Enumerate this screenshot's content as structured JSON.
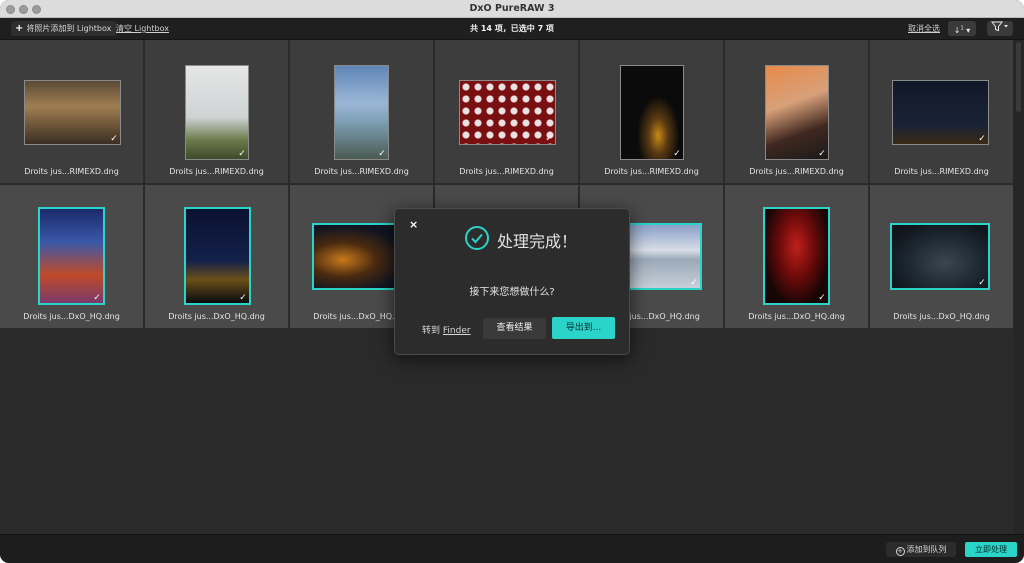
{
  "window": {
    "title": "DxO PureRAW 3"
  },
  "toolbar": {
    "add_label": "将照片添加到 Lightbox",
    "clear_label": "清空 Lightbox",
    "count_label": "共 14 项，已选中 7 项",
    "deselect_label": "取消全选",
    "sort_icon": "sort-icon",
    "filter_icon": "filter-icon"
  },
  "thumbnails": [
    {
      "name": "Droits jus...RIMEXD.dng",
      "selected": false
    },
    {
      "name": "Droits jus...RIMEXD.dng",
      "selected": false
    },
    {
      "name": "Droits jus...RIMEXD.dng",
      "selected": false
    },
    {
      "name": "Droits jus...RIMEXD.dng",
      "selected": false
    },
    {
      "name": "Droits jus...RIMEXD.dng",
      "selected": false
    },
    {
      "name": "Droits jus...RIMEXD.dng",
      "selected": false
    },
    {
      "name": "Droits jus...RIMEXD.dng",
      "selected": false
    },
    {
      "name": "Droits jus...DxO_HQ.dng",
      "selected": true
    },
    {
      "name": "Droits jus...DxO_HQ.dng",
      "selected": true
    },
    {
      "name": "Droits jus...DxO_HQ.dng",
      "selected": true
    },
    {
      "name": "",
      "selected": true
    },
    {
      "name": "Droits jus...DxO_HQ.dng",
      "selected": true
    },
    {
      "name": "Droits jus...DxO_HQ.dng",
      "selected": true
    },
    {
      "name": "Droits jus...DxO_HQ.dng",
      "selected": true
    }
  ],
  "dialog": {
    "title": "处理完成！",
    "question": "接下来您想做什么?",
    "finder_prefix": "转到 ",
    "finder_label": "Finder",
    "view_label": "查看结果",
    "export_label": "导出到..."
  },
  "bottom": {
    "queue_label": "添加到队列",
    "process_label": "立即处理"
  },
  "colors": {
    "accent": "#2ad4c8",
    "background": "#2b2b2b"
  }
}
